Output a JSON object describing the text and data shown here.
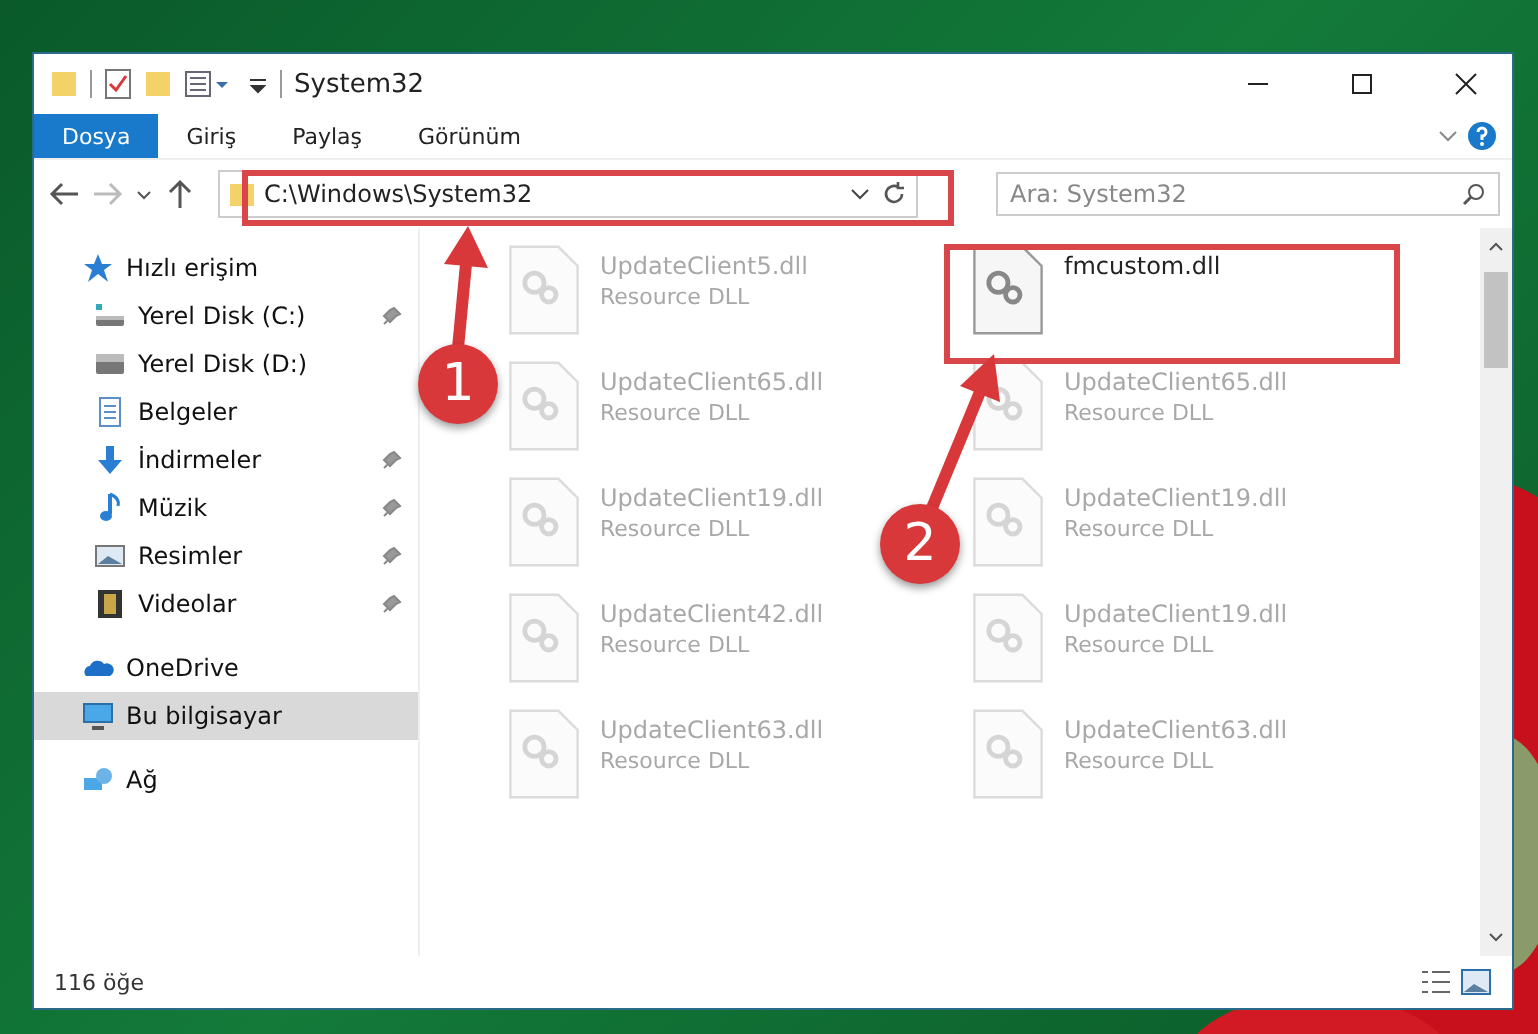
{
  "window": {
    "title": "System32"
  },
  "ribbon": {
    "tabs": [
      {
        "label": "Dosya",
        "selected": true
      },
      {
        "label": "Giriş",
        "selected": false
      },
      {
        "label": "Paylaş",
        "selected": false
      },
      {
        "label": "Görünüm",
        "selected": false
      }
    ]
  },
  "address": {
    "path": "C:\\Windows\\System32"
  },
  "search": {
    "placeholder": "Ara: System32"
  },
  "sidebar": {
    "items": [
      {
        "label": "Hızlı erişim",
        "kind": "quick",
        "pinned": false,
        "selected": false
      },
      {
        "label": "Yerel Disk (C:)",
        "kind": "diskc",
        "pinned": true,
        "selected": false
      },
      {
        "label": "Yerel Disk (D:)",
        "kind": "disk",
        "pinned": false,
        "selected": false
      },
      {
        "label": "Belgeler",
        "kind": "docs",
        "pinned": false,
        "selected": false
      },
      {
        "label": "İndirmeler",
        "kind": "down",
        "pinned": true,
        "selected": false
      },
      {
        "label": "Müzik",
        "kind": "music",
        "pinned": true,
        "selected": false
      },
      {
        "label": "Resimler",
        "kind": "pics",
        "pinned": true,
        "selected": false
      },
      {
        "label": "Videolar",
        "kind": "video",
        "pinned": true,
        "selected": false
      },
      {
        "label": "OneDrive",
        "kind": "cloud",
        "pinned": false,
        "selected": false
      },
      {
        "label": "Bu bilgisayar",
        "kind": "pc",
        "pinned": false,
        "selected": true
      },
      {
        "label": "Ağ",
        "kind": "net",
        "pinned": false,
        "selected": false
      }
    ]
  },
  "files": [
    {
      "name": "UpdateClient5.dll",
      "type": "Resource DLL",
      "blurred": true
    },
    {
      "name": "fmcustom.dll",
      "blurred": false
    },
    {
      "name": "UpdateClient65.dll",
      "type": "Resource DLL",
      "blurred": true
    },
    {
      "name": "UpdateClient65.dll",
      "type": "Resource DLL",
      "blurred": true
    },
    {
      "name": "UpdateClient19.dll",
      "type": "Resource DLL",
      "blurred": true
    },
    {
      "name": "UpdateClient19.dll",
      "type": "Resource DLL",
      "blurred": true
    },
    {
      "name": "UpdateClient42.dll",
      "type": "Resource DLL",
      "blurred": true
    },
    {
      "name": "UpdateClient19.dll",
      "type": "Resource DLL",
      "blurred": true
    },
    {
      "name": "UpdateClient63.dll",
      "type": "Resource DLL",
      "blurred": true
    },
    {
      "name": "UpdateClient63.dll",
      "type": "Resource DLL",
      "blurred": true
    }
  ],
  "status_bar": {
    "count": "116 öğe"
  },
  "annotations": [
    {
      "number": "1"
    },
    {
      "number": "2"
    }
  ]
}
